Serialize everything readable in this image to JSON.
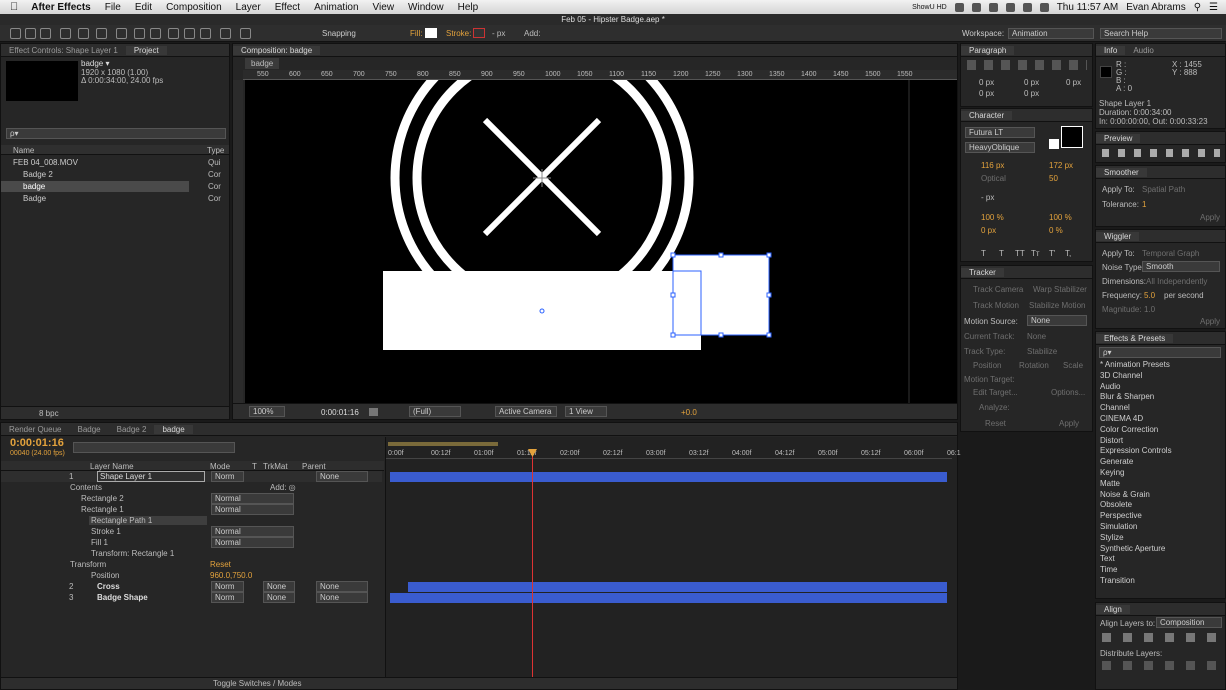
{
  "menubar": {
    "app": "After Effects",
    "items": [
      "File",
      "Edit",
      "Composition",
      "Layer",
      "Effect",
      "Animation",
      "View",
      "Window",
      "Help"
    ],
    "status": "ShowU HD",
    "clock": "Thu 11:57 AM",
    "user": "Evan Abrams"
  },
  "window_title": "Feb 05 - Hipster Badge.aep *",
  "toolbar": {
    "snapping": "Snapping",
    "fill": "Fill:",
    "stroke": "Stroke:",
    "stroke_px": "- px",
    "add": "Add:",
    "workspace_label": "Workspace:",
    "workspace": "Animation",
    "search_placeholder": "Search Help"
  },
  "project": {
    "tabs": [
      "Effect Controls: Shape Layer 1",
      "Project"
    ],
    "comp_name": "badge ▾",
    "comp_res": "1920 x 1080 (1.00)",
    "comp_dur": "Δ 0:00:34:00, 24.00 fps",
    "search_placeholder": "ρ▾",
    "col_name": "Name",
    "col_type": "Type",
    "items": [
      {
        "name": "FEB 04_008.MOV",
        "type": "Qui"
      },
      {
        "name": "Badge 2",
        "type": "Cor"
      },
      {
        "name": "badge",
        "type": "Cor"
      },
      {
        "name": "Badge",
        "type": "Cor"
      }
    ],
    "bpc": "8 bpc"
  },
  "composition": {
    "tab": "Composition: badge",
    "breadcrumb": "badge",
    "ruler": [
      "550",
      "600",
      "650",
      "700",
      "750",
      "800",
      "850",
      "900",
      "950",
      "1000",
      "1050",
      "1100",
      "1150",
      "1200",
      "1250",
      "1300",
      "1350",
      "1400",
      "1450",
      "1500",
      "1550"
    ],
    "zoom": "100%",
    "time": "0:00:01:16",
    "quality": "(Full)",
    "camera": "Active Camera",
    "view": "1 View",
    "exposure": "+0.0"
  },
  "paragraph": {
    "title": "Paragraph",
    "vals": [
      "0 px",
      "0 px",
      "0 px",
      "0 px",
      "0 px"
    ]
  },
  "character": {
    "title": "Character",
    "font": "Futura LT",
    "style": "HeavyOblique",
    "size": "116 px",
    "leading": "172 px",
    "kerning": "Optical",
    "tracking": "50",
    "stroke_w": "- px",
    "vscale": "100 %",
    "hscale": "100 %",
    "baseline": "0 px",
    "tsume": "0 %",
    "caps": [
      "T",
      "T",
      "TT",
      "Tт",
      "T'",
      "T,"
    ]
  },
  "tracker": {
    "title": "Tracker",
    "btns": [
      "Track Camera",
      "Warp Stabilizer",
      "Track Motion",
      "Stabilize Motion"
    ],
    "motion_source_label": "Motion Source:",
    "motion_source": "None",
    "current_track_label": "Current Track:",
    "current_track": "None",
    "track_type_label": "Track Type:",
    "track_type": "Stabilize",
    "opts": [
      "Position",
      "Rotation",
      "Scale"
    ],
    "motion_target": "Motion Target:",
    "edit_target": "Edit Target...",
    "options": "Options...",
    "analyze": "Analyze:",
    "reset": "Reset",
    "apply": "Apply"
  },
  "info": {
    "tabs": [
      "Info",
      "Audio"
    ],
    "rgba": [
      "R :",
      "G :",
      "B :",
      "A : 0"
    ],
    "x": "X : 1455",
    "y": "Y : 888",
    "layer": "Shape Layer 1",
    "duration": "Duration: 0:00:34:00",
    "inout": "In: 0:00:00:00, Out: 0:00:33:23"
  },
  "preview": {
    "title": "Preview"
  },
  "smoother": {
    "title": "Smoother",
    "apply_to_label": "Apply To:",
    "apply_to": "Spatial Path",
    "tol_label": "Tolerance:",
    "tol": "1",
    "apply": "Apply"
  },
  "wiggler": {
    "title": "Wiggler",
    "apply_to_label": "Apply To:",
    "apply_to": "Temporal Graph",
    "noise_label": "Noise Type:",
    "noise": "Smooth",
    "dim_label": "Dimensions:",
    "dim": "All Independently",
    "freq_label": "Frequency:",
    "freq": "5.0",
    "freq_unit": "per second",
    "mag_label": "Magnitude:",
    "mag": "1.0",
    "apply": "Apply"
  },
  "effects": {
    "title": "Effects & Presets",
    "search_placeholder": "ρ▾",
    "cats": [
      "* Animation Presets",
      "3D Channel",
      "Audio",
      "Blur & Sharpen",
      "Channel",
      "CINEMA 4D",
      "Color Correction",
      "Distort",
      "Expression Controls",
      "Generate",
      "Keying",
      "Matte",
      "Noise & Grain",
      "Obsolete",
      "Perspective",
      "Simulation",
      "Stylize",
      "Synthetic Aperture",
      "Text",
      "Time",
      "Transition"
    ]
  },
  "align": {
    "title": "Align",
    "align_to_label": "Align Layers to:",
    "align_to": "Composition",
    "distribute": "Distribute Layers:"
  },
  "timeline": {
    "tabs": [
      "Render Queue",
      "Badge",
      "Badge 2",
      "badge"
    ],
    "timecode": "0:00:01:16",
    "fps": "00040 (24.00 fps)",
    "headers": [
      "Layer Name",
      "Mode",
      "T",
      "TrkMat",
      "Parent"
    ],
    "ruler": [
      "0:00f",
      "00:12f",
      "01:00f",
      "01:12f",
      "02:00f",
      "02:12f",
      "03:00f",
      "03:12f",
      "04:00f",
      "04:12f",
      "05:00f",
      "05:12f",
      "06:00f",
      "06:1"
    ],
    "rows": [
      {
        "num": "1",
        "name": "Shape Layer 1",
        "mode": "Norm",
        "parent": "None"
      },
      {
        "name": "Contents",
        "add": "Add: ◎"
      },
      {
        "name": "Rectangle 2",
        "mode": "Normal"
      },
      {
        "name": "Rectangle 1",
        "mode": "Normal"
      },
      {
        "name": "Rectangle Path 1"
      },
      {
        "name": "Stroke 1",
        "mode": "Normal"
      },
      {
        "name": "Fill 1",
        "mode": "Normal"
      },
      {
        "name": "Transform: Rectangle 1"
      },
      {
        "name": "Transform",
        "reset": "Reset"
      },
      {
        "name": "Position",
        "value": "960.0,750.0"
      },
      {
        "num": "2",
        "name": "Cross",
        "mode": "Norm",
        "trkmat": "None",
        "parent": "None"
      },
      {
        "num": "3",
        "name": "Badge Shape",
        "mode": "Norm",
        "trkmat": "None",
        "parent": "None"
      }
    ],
    "toggle": "Toggle Switches / Modes"
  }
}
